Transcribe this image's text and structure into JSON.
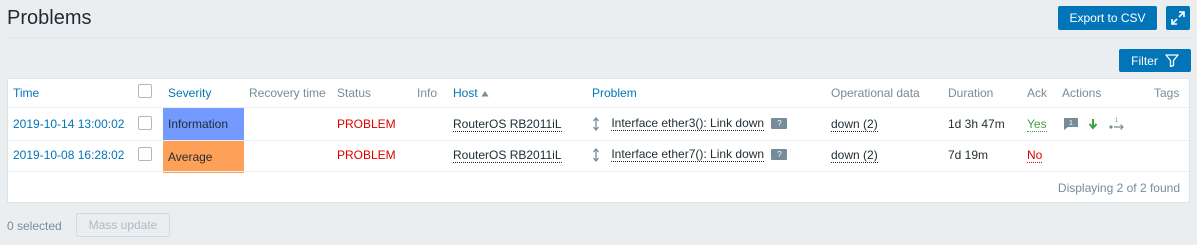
{
  "page": {
    "title": "Problems"
  },
  "toolbar": {
    "export_label": "Export to CSV",
    "fullscreen_icon": "fullscreen-icon"
  },
  "filter": {
    "label": "Filter",
    "icon": "filter-icon"
  },
  "table": {
    "columns": {
      "time": "Time",
      "severity": "Severity",
      "recovery_time": "Recovery time",
      "status": "Status",
      "info": "Info",
      "host": "Host",
      "problem": "Problem",
      "operational_data": "Operational data",
      "duration": "Duration",
      "ack": "Ack",
      "actions": "Actions",
      "tags": "Tags"
    },
    "rows": [
      {
        "time": "2019-10-14 13:00:02",
        "severity": "Information",
        "severity_color": "#7499ff",
        "status": "PROBLEM",
        "host": "RouterOS RB2011iL",
        "problem": "Interface ether3(): Link down",
        "operational_data": "down (2)",
        "duration": "1d 3h 47m",
        "ack": "Yes",
        "actions_count": "1"
      },
      {
        "time": "2019-10-08 16:28:02",
        "severity": "Average",
        "severity_color": "#ffa059",
        "status": "PROBLEM",
        "host": "RouterOS RB2011iL",
        "problem": "Interface ether7(): Link down",
        "operational_data": "down (2)",
        "duration": "7d 19m",
        "ack": "No"
      }
    ],
    "footer": "Displaying 2 of 2 found"
  },
  "bottom": {
    "selected": "0 selected",
    "mass_update_label": "Mass update"
  },
  "colors": {
    "accent": "#0275b8",
    "problem": "#dc0000",
    "ack_yes": "#429e47"
  }
}
